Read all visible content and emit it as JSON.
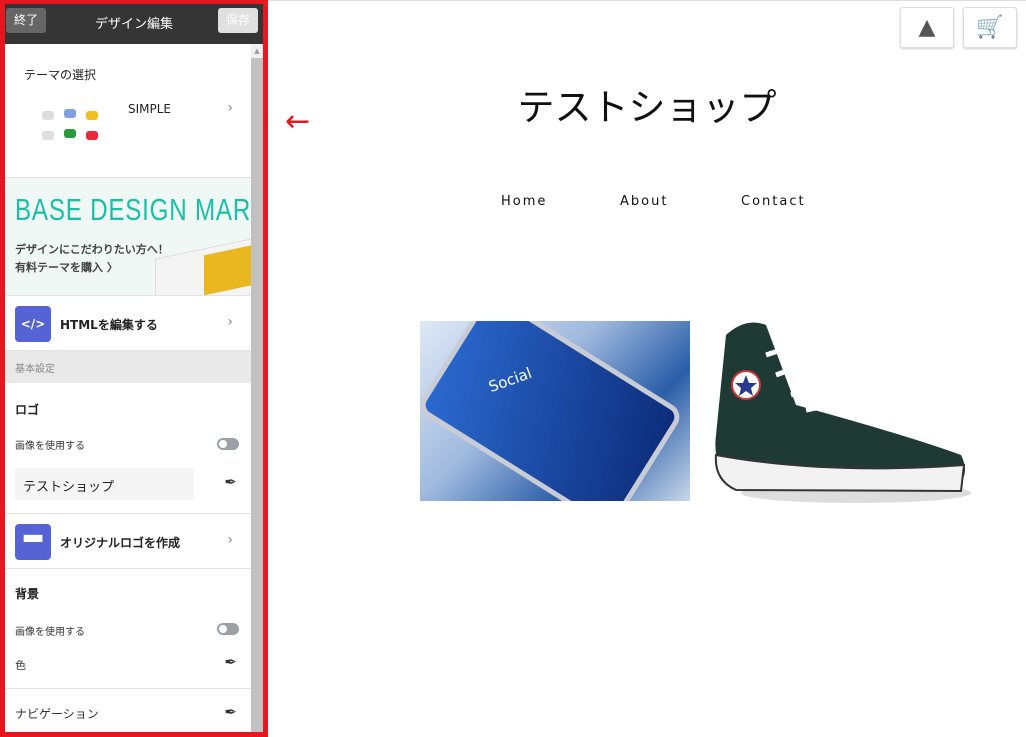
{
  "panel": {
    "quit": "終了",
    "title": "デザイン編集",
    "save": "保存",
    "theme": {
      "heading": "テーマの選択",
      "name": "SIMPLE"
    },
    "banner": {
      "title": "BASE DESIGN MARKET",
      "line1": "デザインにこだわりたい方へ！",
      "line2": "有料テーマを購入 〉"
    },
    "html_edit": {
      "label": "HTMLを編集する",
      "icon": "code-icon"
    },
    "section": "基本設定",
    "logo": {
      "heading": "ロゴ",
      "use_image": "画像を使用する",
      "use_image_on": false,
      "text_value": "テストショップ"
    },
    "original_logo": {
      "label": "オリジナルロゴを作成",
      "icon": "flag-icon"
    },
    "background": {
      "heading": "背景",
      "use_image": "画像を使用する",
      "use_image_on": false,
      "color_label": "色"
    },
    "navigation": {
      "heading": "ナビゲーション"
    }
  },
  "shop": {
    "title": "テストショップ",
    "nav": [
      "Home",
      "About",
      "Contact"
    ],
    "images": [
      "Social"
    ]
  },
  "colors": {
    "highlight": "#e8161f",
    "accent": "#5563d4",
    "teal": "#1bbfa8"
  }
}
